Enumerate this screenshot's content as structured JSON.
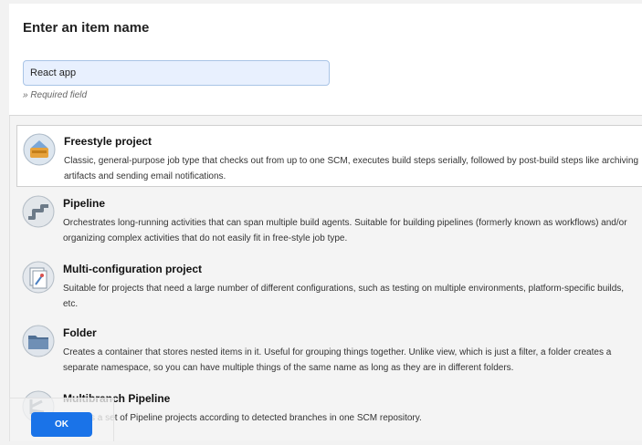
{
  "header": {
    "title": "Enter an item name",
    "name_value": "React app",
    "required_note": "» Required field"
  },
  "items": [
    {
      "label": "Freestyle project",
      "description": "Classic, general-purpose job type that checks out from up to one SCM, executes build steps serially, followed by post-build steps like archiving artifacts and sending email notifications.",
      "icon": "freestyle-icon",
      "selected": true
    },
    {
      "label": "Pipeline",
      "description": "Orchestrates long-running activities that can span multiple build agents. Suitable for building pipelines (formerly known as workflows) and/or organizing complex activities that do not easily fit in free-style job type.",
      "icon": "pipeline-icon"
    },
    {
      "label": "Multi-configuration project",
      "description": "Suitable for projects that need a large number of different configurations, such as testing on multiple environments, platform-specific builds, etc.",
      "icon": "multi-config-icon"
    },
    {
      "label": "Folder",
      "description": "Creates a container that stores nested items in it. Useful for grouping things together. Unlike view, which is just a filter, a folder creates a separate namespace, so you can have multiple things of the same name as long as they are in different folders.",
      "icon": "folder-icon"
    },
    {
      "label": "Multibranch Pipeline",
      "description": "Creates a set of Pipeline projects according to detected branches in one SCM repository.",
      "icon": "multibranch-icon"
    }
  ],
  "footer": {
    "ok_label": "OK"
  },
  "colors": {
    "accent": "#1a73e8",
    "input_bg": "#e8f0fe"
  }
}
